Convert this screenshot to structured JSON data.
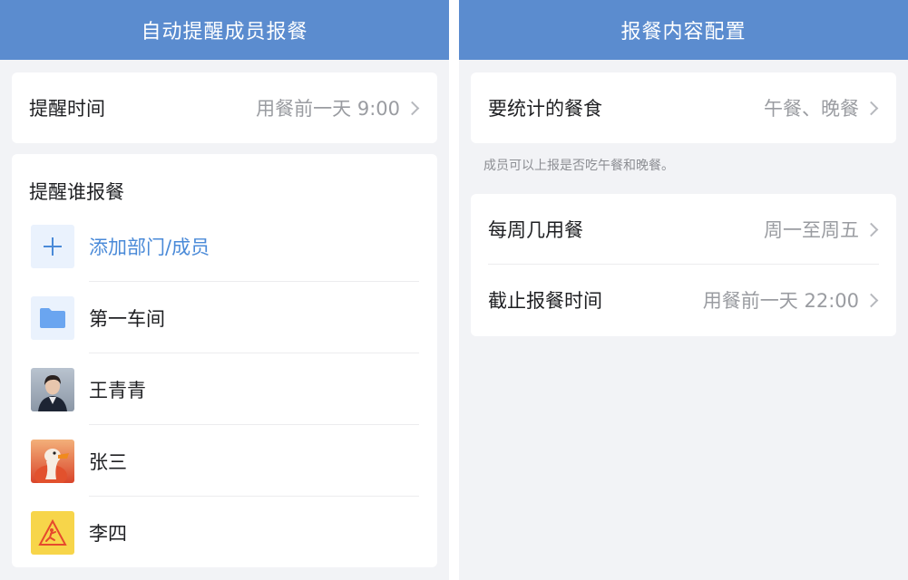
{
  "left_panel": {
    "title": "自动提醒成员报餐",
    "reminder_time": {
      "label": "提醒时间",
      "value": "用餐前一天 9:00"
    },
    "who_section": {
      "title": "提醒谁报餐",
      "add_label": "添加部门/成员",
      "members": [
        {
          "name": "第一车间",
          "icon": "folder-icon"
        },
        {
          "name": "王青青",
          "icon": "avatar-photo"
        },
        {
          "name": "张三",
          "icon": "avatar-duck"
        },
        {
          "name": "李四",
          "icon": "avatar-sign"
        }
      ]
    }
  },
  "right_panel": {
    "title": "报餐内容配置",
    "meals": {
      "label": "要统计的餐食",
      "value": "午餐、晚餐"
    },
    "hint": "成员可以上报是否吃午餐和晚餐。",
    "schedule": {
      "label": "每周几用餐",
      "value": "周一至周五"
    },
    "deadline": {
      "label": "截止报餐时间",
      "value": "用餐前一天 22:00"
    }
  },
  "colors": {
    "header_blue": "#5b8ccf",
    "accent_blue": "#4a8ad8",
    "background": "#f2f3f6"
  }
}
